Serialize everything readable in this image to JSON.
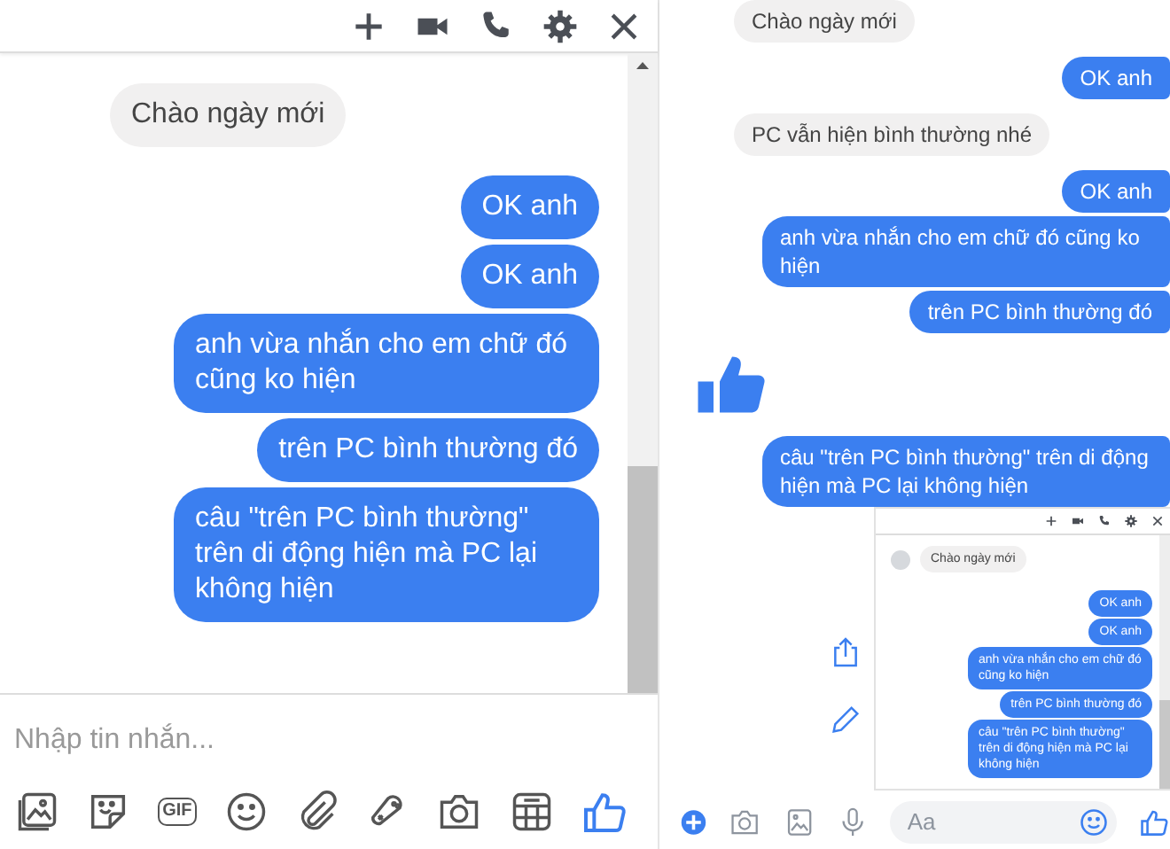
{
  "left_chat": {
    "messages": [
      {
        "kind": "received",
        "text": "Chào ngày mới"
      },
      {
        "kind": "sent",
        "text": "OK anh"
      },
      {
        "kind": "sent",
        "text": "OK anh"
      },
      {
        "kind": "sent",
        "text": "anh vừa nhắn cho em chữ đó cũng ko hiện"
      },
      {
        "kind": "sent",
        "text": "trên PC bình thường đó"
      },
      {
        "kind": "sent",
        "text": "câu \"trên PC bình thường\" trên di động hiện mà PC lại không hiện"
      }
    ],
    "composer": {
      "placeholder": "Nhập tin nhắn..."
    },
    "gif_label": "GIF"
  },
  "right_chat": {
    "messages": [
      {
        "kind": "received",
        "text": "Chào ngày mới"
      },
      {
        "kind": "sent",
        "text": "OK anh"
      },
      {
        "kind": "received",
        "text": "PC vẫn hiện bình thường nhé"
      },
      {
        "kind": "sent",
        "text": "OK anh"
      },
      {
        "kind": "sent",
        "text": "anh vừa nhắn cho em chữ đó cũng ko hiện"
      },
      {
        "kind": "sent",
        "text": "trên PC bình thường đó"
      },
      {
        "kind": "like"
      },
      {
        "kind": "sent",
        "text": "câu \"trên PC bình thường\" trên di động hiện mà PC lại không hiện"
      }
    ],
    "embedded_screenshot": {
      "messages": [
        {
          "kind": "received",
          "text": "Chào ngày mới"
        },
        {
          "kind": "sent",
          "text": "OK anh"
        },
        {
          "kind": "sent",
          "text": "OK anh"
        },
        {
          "kind": "sent",
          "text": "anh vừa nhắn cho em chữ đó cũng ko hiện"
        },
        {
          "kind": "sent",
          "text": "trên PC bình thường đó"
        },
        {
          "kind": "sent",
          "text": "câu \"trên PC bình thường\" trên di động hiện mà PC lại không hiện"
        }
      ]
    },
    "composer": {
      "placeholder": "Aa"
    }
  }
}
